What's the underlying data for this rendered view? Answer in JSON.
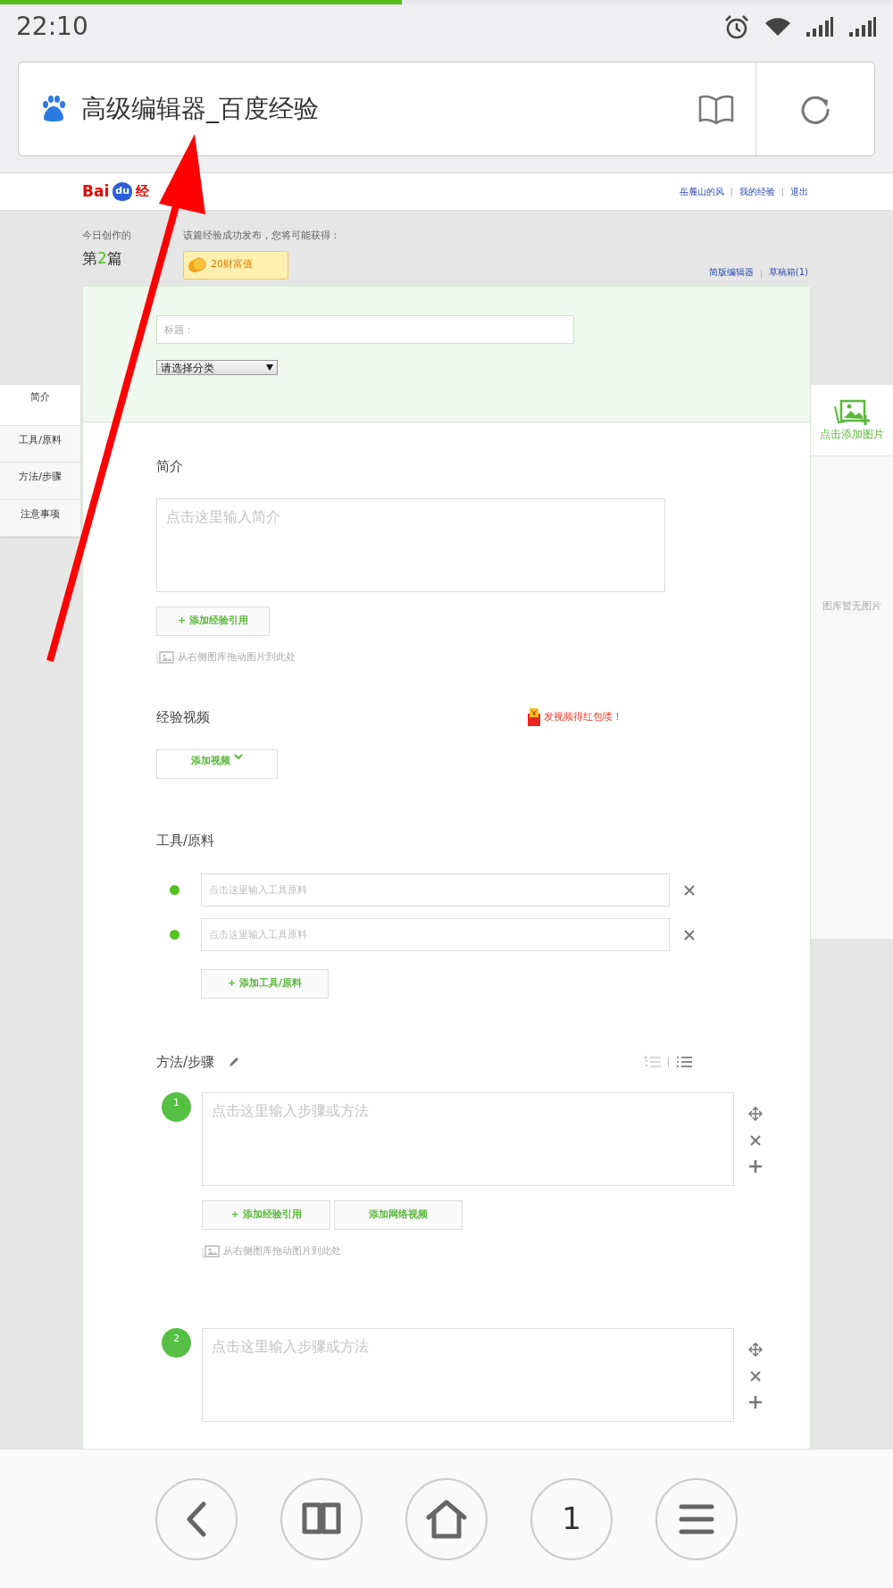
{
  "status_bar": {
    "time": "22:10",
    "page_load": {
      "level": 0.45
    }
  },
  "address_bar": {
    "title": "高级编辑器_百度经验"
  },
  "site_header": {
    "logo": {
      "left": "Bai",
      "paw": "du",
      "right": "经"
    },
    "user_links": [
      "岳麓山的风",
      "我的经验",
      "退出"
    ]
  },
  "stats": {
    "label": "今日创作的",
    "count": {
      "prefix": "第",
      "number": "2",
      "suffix": "篇"
    },
    "reward_note": "该篇经验成功发布，您将可能获得：",
    "reward": "20财富值",
    "editor_links": [
      "简版编辑器",
      "草稿箱(1)"
    ]
  },
  "title_field": {
    "placeholder": "标题："
  },
  "category_select": {
    "value": "请选择分类"
  },
  "side_nav": [
    {
      "label": "简介",
      "selected": true
    },
    {
      "label": "工具/原料",
      "selected": false
    },
    {
      "label": "方法/步骤",
      "selected": false
    },
    {
      "label": "注意事项",
      "selected": false
    }
  ],
  "gallery": {
    "add_label": "点击添加图片",
    "empty_text": "图库暂无图片"
  },
  "intro": {
    "heading": "简介",
    "placeholder": "点击这里输入简介",
    "button": "+ 添加经验引用",
    "drag_hint": "从右侧图库拖动图片到此处"
  },
  "video": {
    "heading": "经验视频",
    "promo": "发视频得红包喽！",
    "button": "添加视频"
  },
  "tools": {
    "heading": "工具/原料",
    "items": [
      {
        "placeholder": "点击这里输入工具原料"
      },
      {
        "placeholder": "点击这里输入工具原料"
      }
    ],
    "button": "+ 添加工具/原料"
  },
  "steps": {
    "heading": "方法/步骤",
    "items": [
      {
        "number": "1",
        "placeholder": "点击这里输入步骤或方法",
        "buttons": [
          "+ 添加经验引用",
          "添加网络视频"
        ],
        "drag_hint": "从右侧图库拖动图片到此处"
      },
      {
        "number": "2",
        "placeholder": "点击这里输入步骤或方法"
      }
    ]
  },
  "bottom_nav": {
    "tab_count": "1"
  }
}
